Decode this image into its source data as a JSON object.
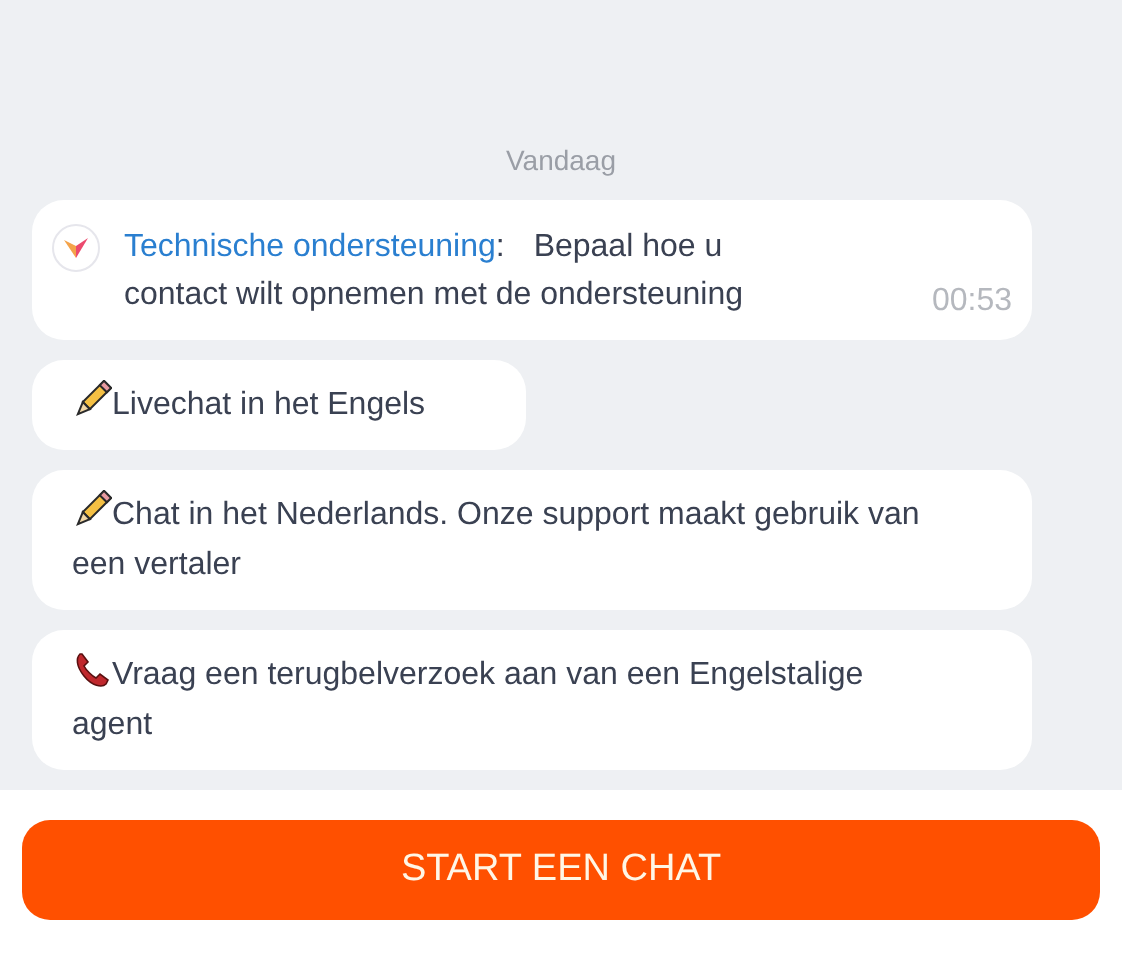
{
  "chat": {
    "date_separator": "Vandaag",
    "message": {
      "sender": "Technische ondersteuning",
      "separator": ":",
      "text": "Bepaal hoe u contact wilt opnemen met de ondersteuning",
      "time": "00:53"
    },
    "options": [
      {
        "kind": "pencil",
        "text": "Livechat in het Engels"
      },
      {
        "kind": "pencil",
        "text": "Chat in het Nederlands. Onze support maakt gebruik van een vertaler"
      },
      {
        "kind": "phone",
        "text": "Vraag een terugbelverzoek aan van een Engelstalige agent"
      }
    ]
  },
  "button": {
    "label": "START EEN CHAT"
  }
}
